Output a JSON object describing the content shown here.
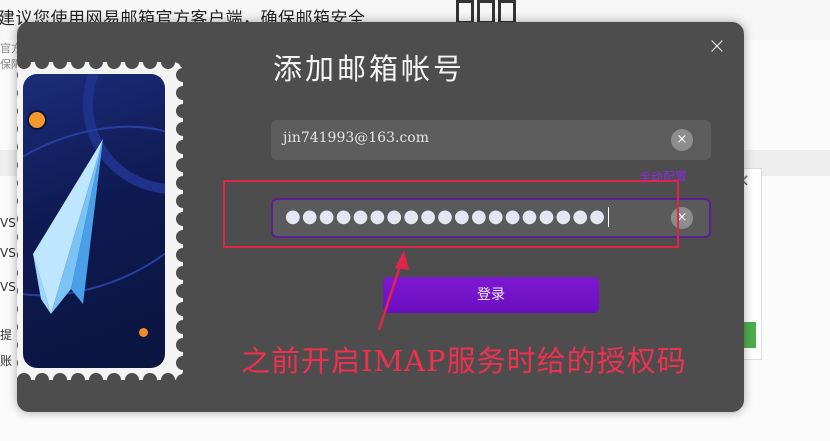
{
  "background": {
    "banner_text": "建议您使用网易邮箱官方客户端，确保邮箱安全",
    "side_text_1": "官方",
    "side_text_2": "保障",
    "side_labels": [
      "VSN",
      "VSN",
      "VSN"
    ],
    "side_text_3": "提",
    "side_text_4": "账"
  },
  "modal": {
    "title": "添加邮箱帐号",
    "close_label": "×",
    "email_value": "jin741993@163.com",
    "password_masked": "●●●●●●●●●●●●●●●●●●●",
    "clear_label": "×",
    "manual_config_label": "手动配置",
    "login_label": "登录"
  },
  "annotation": {
    "note": "之前开启IMAP服务时给的授权码",
    "color": "#f0304f"
  },
  "colors": {
    "modal_bg": "#4d4d4d",
    "accent_purple": "#7e18d3",
    "annotation_red": "#e0254a"
  }
}
